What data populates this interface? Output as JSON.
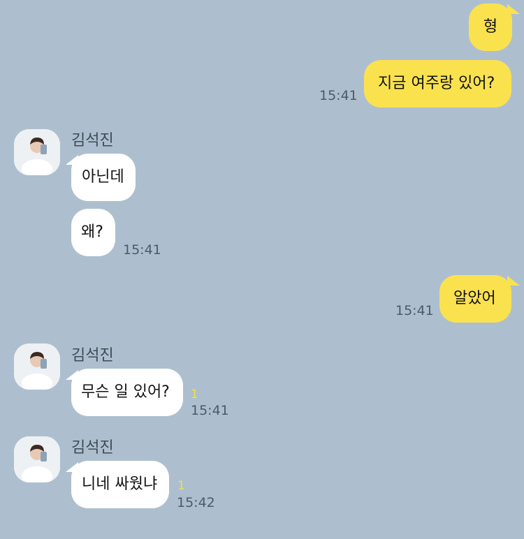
{
  "messages": [
    {
      "id": "m1",
      "side": "me",
      "text": "형"
    },
    {
      "id": "m2",
      "side": "me",
      "text": "지금 여주랑 있어?",
      "time": "15:41"
    },
    {
      "id": "g1",
      "side": "them",
      "sender": "김석진",
      "items": [
        {
          "text": "아닌데"
        },
        {
          "text": "왜?",
          "time": "15:41"
        }
      ]
    },
    {
      "id": "m3",
      "side": "me",
      "text": "알았어",
      "time": "15:41"
    },
    {
      "id": "g2",
      "side": "them",
      "sender": "김석진",
      "items": [
        {
          "text": "무슨 일 있어?",
          "unread": "1",
          "time": "15:41"
        }
      ]
    },
    {
      "id": "g3",
      "side": "them",
      "sender": "김석진",
      "items": [
        {
          "text": "니네 싸웠냐",
          "unread": "1",
          "time": "15:42"
        }
      ]
    }
  ],
  "colors": {
    "background": "#adbfcf",
    "my_bubble": "#fae24f",
    "their_bubble": "#ffffff",
    "unread_count": "#f6df3f"
  },
  "icons": {
    "avatar": "profile-photo"
  }
}
